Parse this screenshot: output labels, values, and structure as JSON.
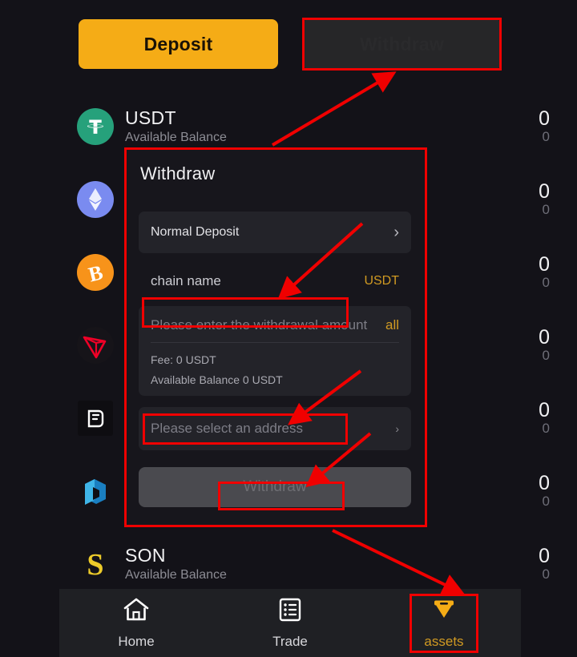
{
  "tabs": {
    "deposit_label": "Deposit",
    "withdraw_label": "Withdraw"
  },
  "assets": {
    "sub_label": "Available Balance",
    "rows": [
      {
        "name": "USDT",
        "sub": "Available Balance",
        "balance": "0",
        "balance_sub": "0",
        "icon": "usdt-icon"
      },
      {
        "name": "",
        "sub": "",
        "balance": "0",
        "balance_sub": "0",
        "icon": "ethereum-icon"
      },
      {
        "name": "",
        "sub": "",
        "balance": "0",
        "balance_sub": "0",
        "icon": "bitcoin-icon"
      },
      {
        "name": "",
        "sub": "",
        "balance": "0",
        "balance_sub": "0",
        "icon": "tron-icon"
      },
      {
        "name": "",
        "sub": "",
        "balance": "0",
        "balance_sub": "0",
        "icon": "filecoin-icon"
      },
      {
        "name": "",
        "sub": "",
        "balance": "0",
        "balance_sub": "0",
        "icon": "dusk-icon"
      },
      {
        "name": "SON",
        "sub": "Available Balance",
        "balance": "0",
        "balance_sub": "0",
        "icon": "son-icon"
      }
    ]
  },
  "modal": {
    "title": "Withdraw",
    "deposit_type_label": "Normal Deposit",
    "chain_label": "chain name",
    "chain_value": "USDT",
    "amount_placeholder": "Please enter the withdrawal amount",
    "amount_all_label": "all",
    "fee_label": "Fee: 0 USDT",
    "available_label": "Available Balance 0 USDT",
    "address_placeholder": "Please select an address",
    "submit_label": "Withdraw"
  },
  "bottomnav": {
    "items": [
      {
        "label": "Home",
        "icon": "home-icon",
        "active": false
      },
      {
        "label": "Trade",
        "icon": "list-icon",
        "active": false
      },
      {
        "label": "assets",
        "icon": "diamond-icon",
        "active": true
      }
    ]
  },
  "colors": {
    "accent": "#f5ac16",
    "gold_text": "#d09a22",
    "background": "#131218",
    "panel": "#232329",
    "modal": "#17161c",
    "annotation": "#f00000"
  }
}
